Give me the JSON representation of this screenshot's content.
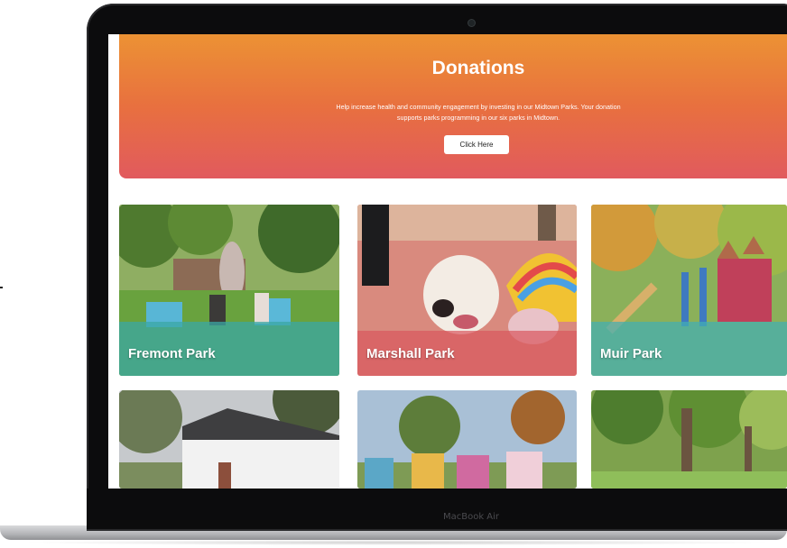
{
  "banner": {
    "title": "Donations",
    "text": "Help increase health and community engagement by investing in our Midtown Parks. Your donation supports parks programming in our six parks in Midtown.",
    "button_label": "Click Here"
  },
  "parks": [
    {
      "name": "Fremont Park"
    },
    {
      "name": "Marshall Park"
    },
    {
      "name": "Muir Park"
    }
  ],
  "device": {
    "label": "MacBook Air"
  },
  "colors": {
    "banner_top": "#ec9234",
    "banner_bottom": "#e15a5e"
  }
}
